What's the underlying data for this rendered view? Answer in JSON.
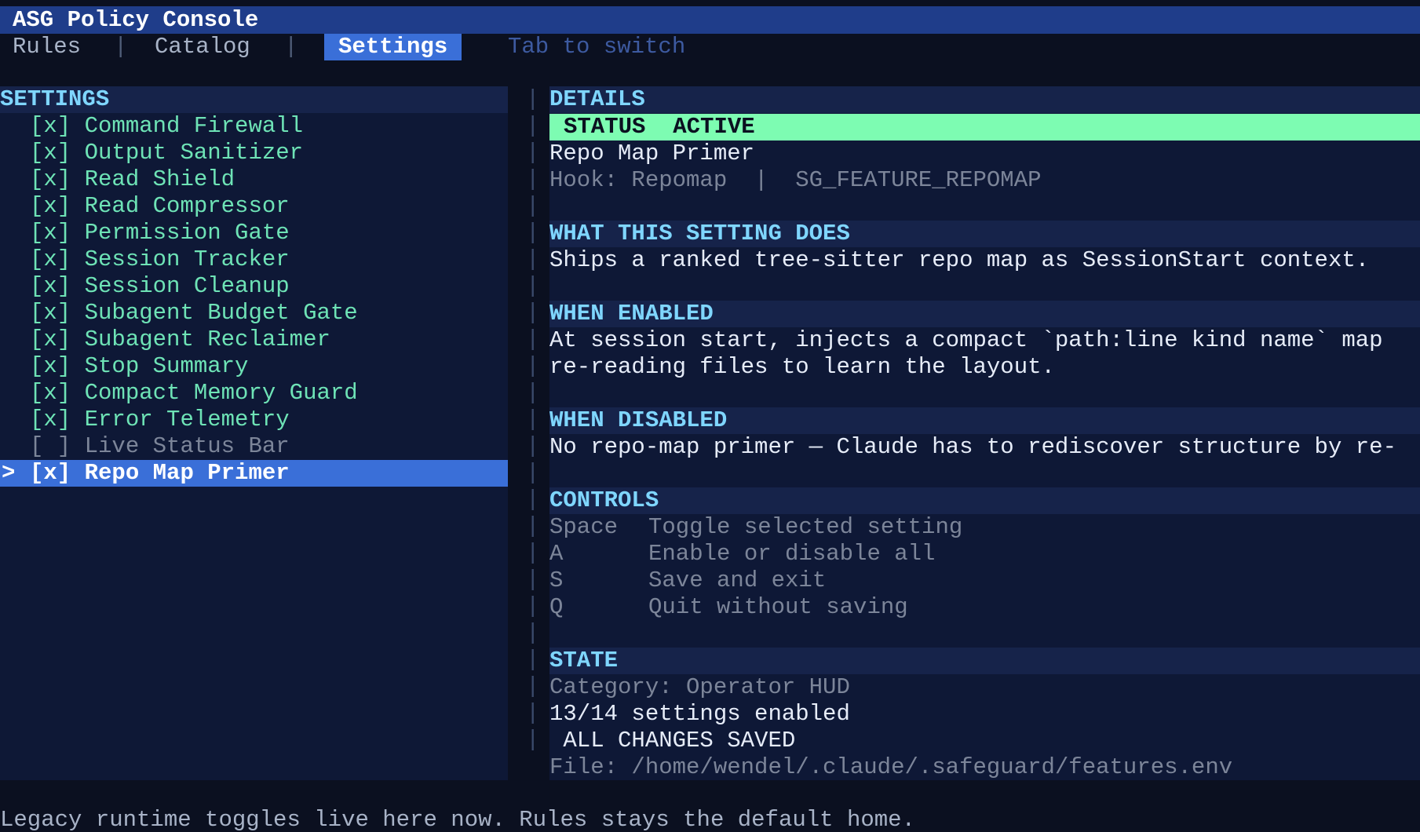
{
  "app": {
    "title": "ASG Policy Console"
  },
  "tabs": {
    "rules": "Rules",
    "separator": "|",
    "catalog": "Catalog",
    "settings": "Settings",
    "hint": "Tab to switch"
  },
  "settings_panel": {
    "heading": "SETTINGS",
    "items": [
      {
        "check": "[x]",
        "label": "Command Firewall",
        "enabled": true
      },
      {
        "check": "[x]",
        "label": "Output Sanitizer",
        "enabled": true
      },
      {
        "check": "[x]",
        "label": "Read Shield",
        "enabled": true
      },
      {
        "check": "[x]",
        "label": "Read Compressor",
        "enabled": true
      },
      {
        "check": "[x]",
        "label": "Permission Gate",
        "enabled": true
      },
      {
        "check": "[x]",
        "label": "Session Tracker",
        "enabled": true
      },
      {
        "check": "[x]",
        "label": "Session Cleanup",
        "enabled": true
      },
      {
        "check": "[x]",
        "label": "Subagent Budget Gate",
        "enabled": true
      },
      {
        "check": "[x]",
        "label": "Subagent Reclaimer",
        "enabled": true
      },
      {
        "check": "[x]",
        "label": "Stop Summary",
        "enabled": true
      },
      {
        "check": "[x]",
        "label": "Compact Memory Guard",
        "enabled": true
      },
      {
        "check": "[x]",
        "label": "Error Telemetry",
        "enabled": true
      },
      {
        "check": "[ ]",
        "label": "Live Status Bar",
        "enabled": false
      },
      {
        "check": "[x]",
        "label": "Repo Map Primer",
        "enabled": true,
        "selected": true,
        "cursor": ">"
      }
    ]
  },
  "details": {
    "heading": "DETAILS",
    "status_label": "STATUS",
    "status_value": "ACTIVE",
    "name": "Repo Map Primer",
    "hook": "Hook: Repomap  |  SG_FEATURE_REPOMAP",
    "what_heading": "WHAT THIS SETTING DOES",
    "what_text": "Ships a ranked tree-sitter repo map as SessionStart context.",
    "enabled_heading": "WHEN ENABLED",
    "enabled_line1": "At session start, injects a compact `path:line kind name` map",
    "enabled_line2": "re-reading files to learn the layout.",
    "disabled_heading": "WHEN DISABLED",
    "disabled_text": "No repo-map primer — Claude has to rediscover structure by re-",
    "controls_heading": "CONTROLS",
    "controls": [
      {
        "key": "Space",
        "desc": "Toggle selected setting"
      },
      {
        "key": "A",
        "desc": "Enable or disable all"
      },
      {
        "key": "S",
        "desc": "Save and exit"
      },
      {
        "key": "Q",
        "desc": "Quit without saving"
      }
    ],
    "state_heading": "STATE",
    "category": "Category: Operator HUD",
    "enabled_count": "13/14 settings enabled",
    "save_state": " ALL CHANGES SAVED",
    "file": "File: /home/wendel/.claude/.safeguard/features.env"
  },
  "footer": {
    "text": "Legacy runtime toggles live here now. Rules stays the default home."
  },
  "colors": {
    "title_bar": "#1f3d8a",
    "active_tab": "#3a6fd8",
    "status_active": "#7dfcb2",
    "enabled_item": "#6ee3b6",
    "heading": "#7fd6ff"
  }
}
